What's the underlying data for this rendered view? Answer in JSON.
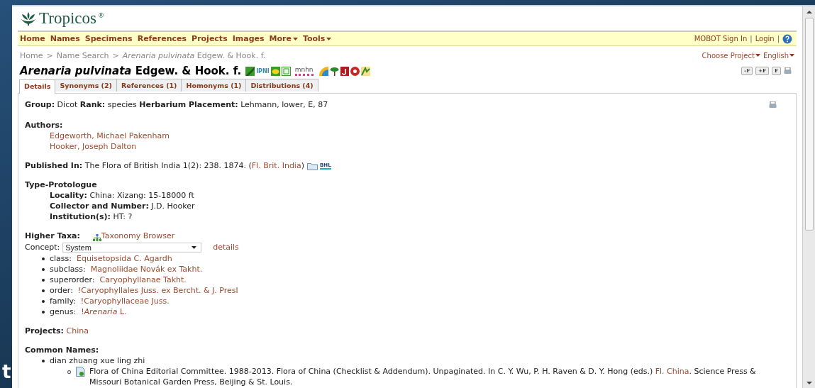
{
  "backdrop_text": "t",
  "logo": {
    "text": "Tropicos",
    "mark": "®"
  },
  "nav": {
    "items": [
      {
        "label": "Home",
        "dropdown": false
      },
      {
        "label": "Names",
        "dropdown": false
      },
      {
        "label": "Specimens",
        "dropdown": false
      },
      {
        "label": "References",
        "dropdown": false
      },
      {
        "label": "Projects",
        "dropdown": false
      },
      {
        "label": "Images",
        "dropdown": false
      },
      {
        "label": "More",
        "dropdown": true
      },
      {
        "label": "Tools",
        "dropdown": true
      }
    ],
    "account": [
      "MOBOT Sign In",
      "Login"
    ],
    "separator": "|"
  },
  "breadcrumb_separator": ">",
  "breadcrumb": [
    "Home",
    "Name Search",
    "*Arenaria pulvinata* Edgew. & Hook. f."
  ],
  "menus": [
    {
      "label": "Choose Project"
    },
    {
      "label": "English"
    }
  ],
  "title": "*Arenaria pulvinata* Edgew. & Hook. f.",
  "title_badges": {
    "ipni": "IPNI",
    "mnhn": "mnhn"
  },
  "font_buttons": [
    "-F",
    "+F",
    "F"
  ],
  "tabs": [
    {
      "label": "Details",
      "selected": true
    },
    {
      "label": "Synonyms (2)",
      "selected": false
    },
    {
      "label": "References (1)",
      "selected": false
    },
    {
      "label": "Homonyms (1)",
      "selected": false
    },
    {
      "label": "Distributions (4)",
      "selected": false
    }
  ],
  "summary": "**Group:** Dicot **Rank:** species **Herbarium Placement:** Lehmann, lower, E, 87",
  "authors": {
    "label": "Authors:",
    "names": [
      "Edgeworth, Michael Pakenham",
      "Hooker, Joseph Dalton"
    ]
  },
  "published": {
    "label": "Published In:",
    "text": "The Flora of British India 1(2): 238. 1874. (",
    "link": "Fl. Brit. India",
    "after": ")",
    "bhl": "BHL"
  },
  "type_protologue": {
    "label": "Type-Protologue",
    "fields": [
      "**Locality:** China: Xizang: 15-18000 ft",
      "**Collector and Number:** J.D. Hooker",
      "**Institution(s):** HT: ?"
    ]
  },
  "higher_taxa": {
    "label": "Higher Taxa:",
    "browser_link": "Taxonomy Browser",
    "concept_label": "Concept:",
    "concept_value": "System",
    "details_link": "details",
    "taxa": [
      {
        "rank": "class:",
        "name": "Equisetopsida C. Agardh"
      },
      {
        "rank": "subclass:",
        "name": "Magnoliidae Novák ex Takht."
      },
      {
        "rank": "superorder:",
        "name": "Caryophyllanae Takht."
      },
      {
        "rank": "order:",
        "name": "!Caryophyllales Juss. ex Bercht. & J. Presl"
      },
      {
        "rank": "family:",
        "name": "!Caryophyllaceae Juss."
      },
      {
        "rank": "genus:",
        "name": "!*Arenaria* L."
      }
    ]
  },
  "projects": {
    "label": "Projects:",
    "link": "China"
  },
  "common_names": {
    "label": "Common Names:",
    "items": [
      {
        "name": "dian zhuang xue ling zhi",
        "references": [
          {
            "text": "Flora of China Editorial Committee. 1988-2013. Flora of China (Checklist & Addendum). Unpaginated. In C. Y. Wu, P. H. Raven & D. Y. Hong (eds.) ",
            "link": "Fl. China",
            "after": ". Science Press & Missouri Botanical Garden Press, Beijing & St. Louis."
          }
        ]
      }
    ]
  }
}
